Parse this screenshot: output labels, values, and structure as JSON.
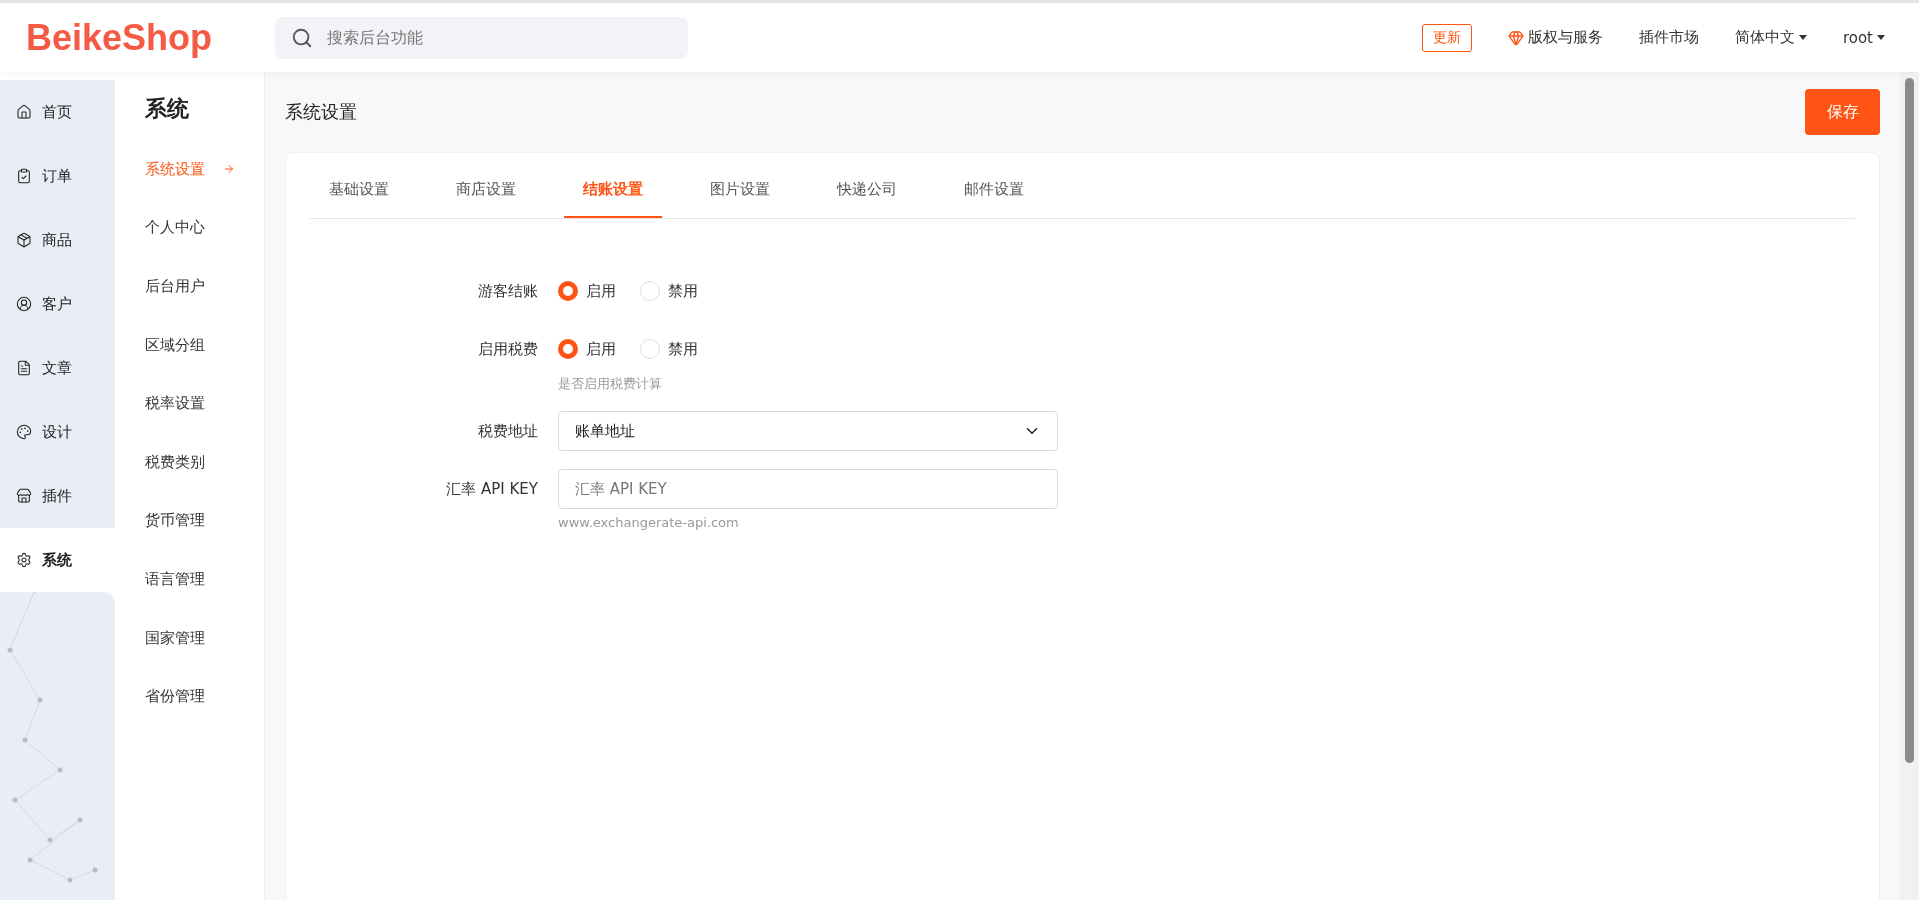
{
  "header": {
    "logo": "BeikeShop",
    "search": {
      "placeholder": "搜索后台功能"
    },
    "update_badge": "更新",
    "links": [
      {
        "kind": "diamond",
        "label": "版权与服务"
      },
      {
        "kind": "plain",
        "label": "插件市场"
      },
      {
        "kind": "dropdown",
        "label": "简体中文"
      },
      {
        "kind": "dropdown",
        "label": "root"
      }
    ]
  },
  "main_nav": [
    {
      "label": "首页",
      "selected": false
    },
    {
      "label": "订单",
      "selected": false
    },
    {
      "label": "商品",
      "selected": false
    },
    {
      "label": "客户",
      "selected": false
    },
    {
      "label": "文章",
      "selected": false
    },
    {
      "label": "设计",
      "selected": false
    },
    {
      "label": "插件",
      "selected": false
    },
    {
      "label": "系统",
      "selected": true
    }
  ],
  "sub_nav": {
    "title": "系统",
    "items": [
      {
        "label": "系统设置",
        "selected": true
      },
      {
        "label": "个人中心",
        "selected": false
      },
      {
        "label": "后台用户",
        "selected": false
      },
      {
        "label": "区域分组",
        "selected": false
      },
      {
        "label": "税率设置",
        "selected": false
      },
      {
        "label": "税费类别",
        "selected": false
      },
      {
        "label": "货币管理",
        "selected": false
      },
      {
        "label": "语言管理",
        "selected": false
      },
      {
        "label": "国家管理",
        "selected": false
      },
      {
        "label": "省份管理",
        "selected": false
      }
    ]
  },
  "page": {
    "title": "系统设置",
    "save_button": "保存",
    "tabs": [
      {
        "label": "基础设置",
        "selected": false
      },
      {
        "label": "商店设置",
        "selected": false
      },
      {
        "label": "结账设置",
        "selected": true
      },
      {
        "label": "图片设置",
        "selected": false
      },
      {
        "label": "快递公司",
        "selected": false
      },
      {
        "label": "邮件设置",
        "selected": false
      }
    ],
    "form": [
      {
        "kind": "radio",
        "label": "游客结账",
        "options": [
          {
            "label": "启用",
            "selected": true
          },
          {
            "label": "禁用",
            "selected": false
          }
        ]
      },
      {
        "kind": "radio",
        "label": "启用税费",
        "options": [
          {
            "label": "启用",
            "selected": true
          },
          {
            "label": "禁用",
            "selected": false
          }
        ],
        "hint": "是否启用税费计算"
      },
      {
        "kind": "select",
        "label": "税费地址",
        "value": "账单地址"
      },
      {
        "kind": "input",
        "label": "汇率 API KEY",
        "placeholder": "汇率 API KEY",
        "hint": "www.exchangerate-api.com"
      }
    ]
  }
}
